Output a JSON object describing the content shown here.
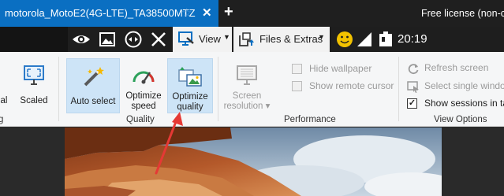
{
  "tab": {
    "title": "motorola_MotoE2(4G-LTE)_TA38500MTZ",
    "close_glyph": "✕",
    "star_glyph": "☆"
  },
  "titlebar": {
    "new_tab_glyph": "+",
    "license_text": "Free license (non-co"
  },
  "toolbar": {
    "view_label": "View",
    "files_label": "Files & Extras",
    "clock": "20:19",
    "icons": [
      "eye-icon",
      "image-icon",
      "remote-target-icon",
      "close-icon",
      "view-monitor-icon",
      "files-icon",
      "smiley-icon",
      "signal-icon",
      "battery-icon"
    ]
  },
  "ribbon": {
    "partial_left_label": "al",
    "partial_left_group": "g",
    "scaled_label": "Scaled",
    "auto_select_label": "Auto select",
    "optimize_speed_label_1": "Optimize",
    "optimize_speed_label_2": "speed",
    "optimize_quality_label_1": "Optimize",
    "optimize_quality_label_2": "quality",
    "quality_group_label": "Quality",
    "screen_resolution_label_1": "Screen",
    "screen_resolution_label_2": "resolution ▾",
    "hide_wallpaper_label": "Hide wallpaper",
    "show_remote_cursor_label": "Show remote cursor",
    "performance_group_label": "Performance",
    "refresh_screen_label": "Refresh screen",
    "select_single_window_label": "Select single windo",
    "show_sessions_label": "Show sessions in ta",
    "view_options_group_label": "View Options",
    "show_sessions_checked_glyph": "✓"
  },
  "colors": {
    "tab_blue": "#0a6fc2",
    "selected_button": "#cde4f7",
    "annotation_arrow": "#e53935"
  }
}
